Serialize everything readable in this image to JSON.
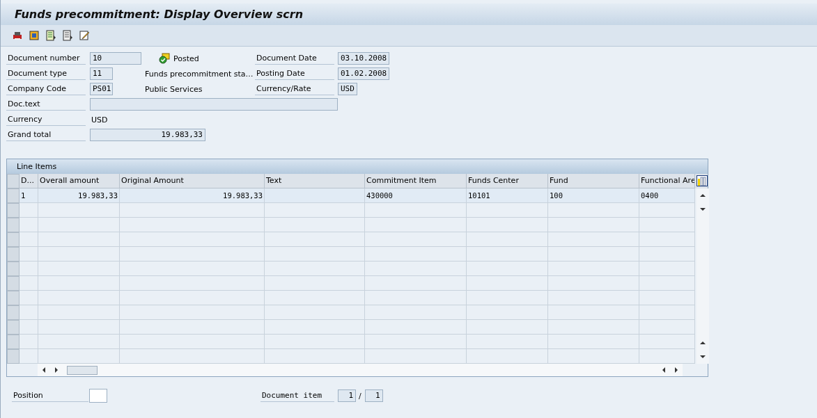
{
  "window": {
    "title": "Funds precommitment: Display Overview scrn"
  },
  "header": {
    "rows": [
      {
        "label": "Document number",
        "value": "10",
        "middle": {
          "kind": "status",
          "text": "Posted"
        },
        "right_label": "Document Date",
        "right_value": "03.10.2008"
      },
      {
        "label": "Document type",
        "value": "11",
        "middle": {
          "kind": "text",
          "text": "Funds precommitment sta…"
        },
        "right_label": "Posting Date",
        "right_value": "01.02.2008"
      },
      {
        "label": "Company Code",
        "value": "PS01",
        "middle": {
          "kind": "text",
          "text": "Public Services"
        },
        "right_label": "Currency/Rate",
        "right_value": "USD"
      }
    ],
    "doc_text": {
      "label": "Doc.text"
    },
    "currency": {
      "label": "Currency",
      "value": "USD"
    },
    "grand_total": {
      "label": "Grand total",
      "value": "19.983,33"
    }
  },
  "table": {
    "title": "Line Items",
    "columns": [
      "D...",
      "Overall amount",
      "Original Amount",
      "Text",
      "Commitment Item",
      "Funds Center",
      "Fund",
      "Functional Are"
    ],
    "rows": [
      {
        "cells": [
          "1",
          "19.983,33",
          "19.983,33",
          "",
          "430000",
          "10101",
          "100",
          "0400"
        ]
      }
    ]
  },
  "footer": {
    "position": {
      "label": "Position"
    },
    "document_item": {
      "label": "Document item",
      "current": "1",
      "separator": "/",
      "total": "1"
    }
  }
}
